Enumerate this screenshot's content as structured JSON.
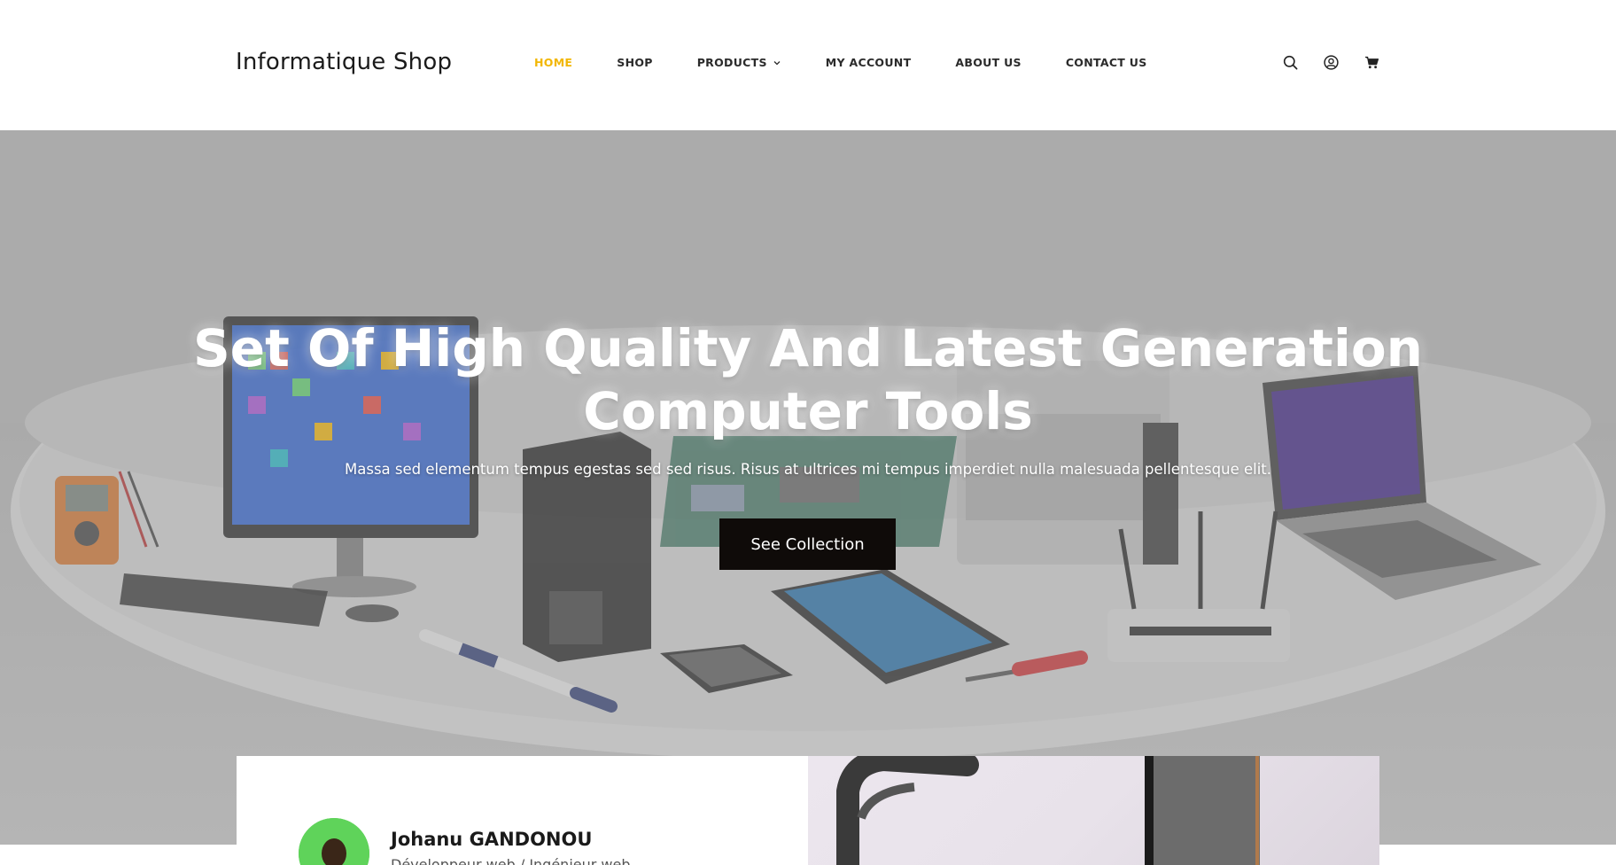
{
  "brand": {
    "name": "Informatique Shop"
  },
  "nav": {
    "items": [
      {
        "label": "HOME",
        "active": true
      },
      {
        "label": "SHOP",
        "active": false
      },
      {
        "label": "PRODUCTS",
        "active": false,
        "has_dropdown": true
      },
      {
        "label": "MY ACCOUNT",
        "active": false
      },
      {
        "label": "ABOUT US",
        "active": false
      },
      {
        "label": "CONTACT US",
        "active": false
      }
    ],
    "icons": [
      "search-icon",
      "account-icon",
      "cart-icon"
    ]
  },
  "hero": {
    "title_line1": "Set Of High Quality And Latest Generation",
    "title_line2": "Computer Tools",
    "subtitle": "Massa sed elementum tempus egestas sed sed risus. Risus at ultrices mi tempus imperdiet nulla malesuada pellentesque elit.",
    "button_label": "See Collection"
  },
  "team": {
    "member_name": "Johanu GANDONOU",
    "member_role": "Développeur web / Ingénieur web"
  },
  "colors": {
    "accent": "#f2b705",
    "button_bg": "#0f0b09",
    "avatar_bg": "#5fd35a"
  }
}
